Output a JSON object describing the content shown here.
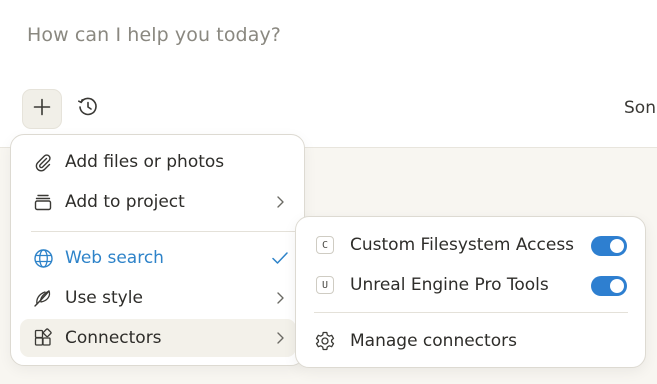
{
  "composer": {
    "placeholder": "How can I help you today?",
    "model_label": "Son"
  },
  "menu": {
    "items": [
      {
        "label": "Add files or photos",
        "icon": "paperclip-icon"
      },
      {
        "label": "Add to project",
        "icon": "project-stack-icon",
        "has_submenu": true
      },
      {
        "label": "Web search",
        "icon": "globe-icon",
        "checked": true
      },
      {
        "label": "Use style",
        "icon": "feather-icon",
        "has_submenu": true
      },
      {
        "label": "Connectors",
        "icon": "connectors-icon",
        "has_submenu": true,
        "active": true
      }
    ]
  },
  "connectors": {
    "items": [
      {
        "badge": "C",
        "label": "Custom Filesystem Access",
        "enabled": true
      },
      {
        "badge": "U",
        "label": "Unreal Engine Pro Tools",
        "enabled": true
      }
    ],
    "manage_label": "Manage connectors"
  },
  "colors": {
    "accent_blue": "#2e83c9",
    "toggle_on": "#2e7fd0",
    "background": "#f8f6f1"
  }
}
